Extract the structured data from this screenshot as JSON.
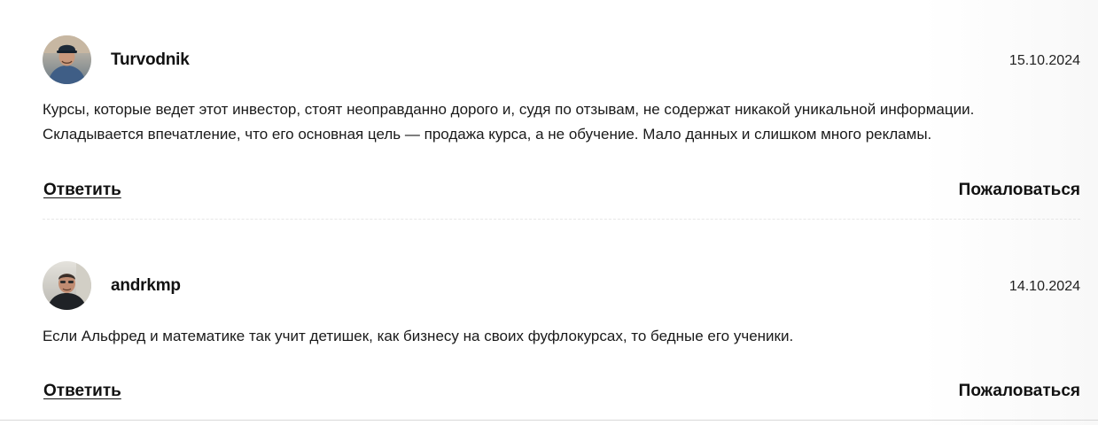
{
  "comments": [
    {
      "username": "Turvodnik",
      "date": "15.10.2024",
      "text_lines": [
        "Курсы, которые ведет этот инвестор, стоят неоправданно дорого и, судя по отзывам, не содержат никакой уникальной информации.",
        "Складывается впечатление, что его основная цель — продажа курса, а не обучение. Мало данных и слишком много рекламы."
      ],
      "reply_label": "Ответить",
      "report_label": "Пожаловаться"
    },
    {
      "username": "andrkmp",
      "date": "14.10.2024",
      "text_lines": [
        "Если Альфред и математике так учит детишек, как бизнесу на своих фуфлокурсах, то бедные его ученики."
      ],
      "reply_label": "Ответить",
      "report_label": "Пожаловаться"
    }
  ]
}
